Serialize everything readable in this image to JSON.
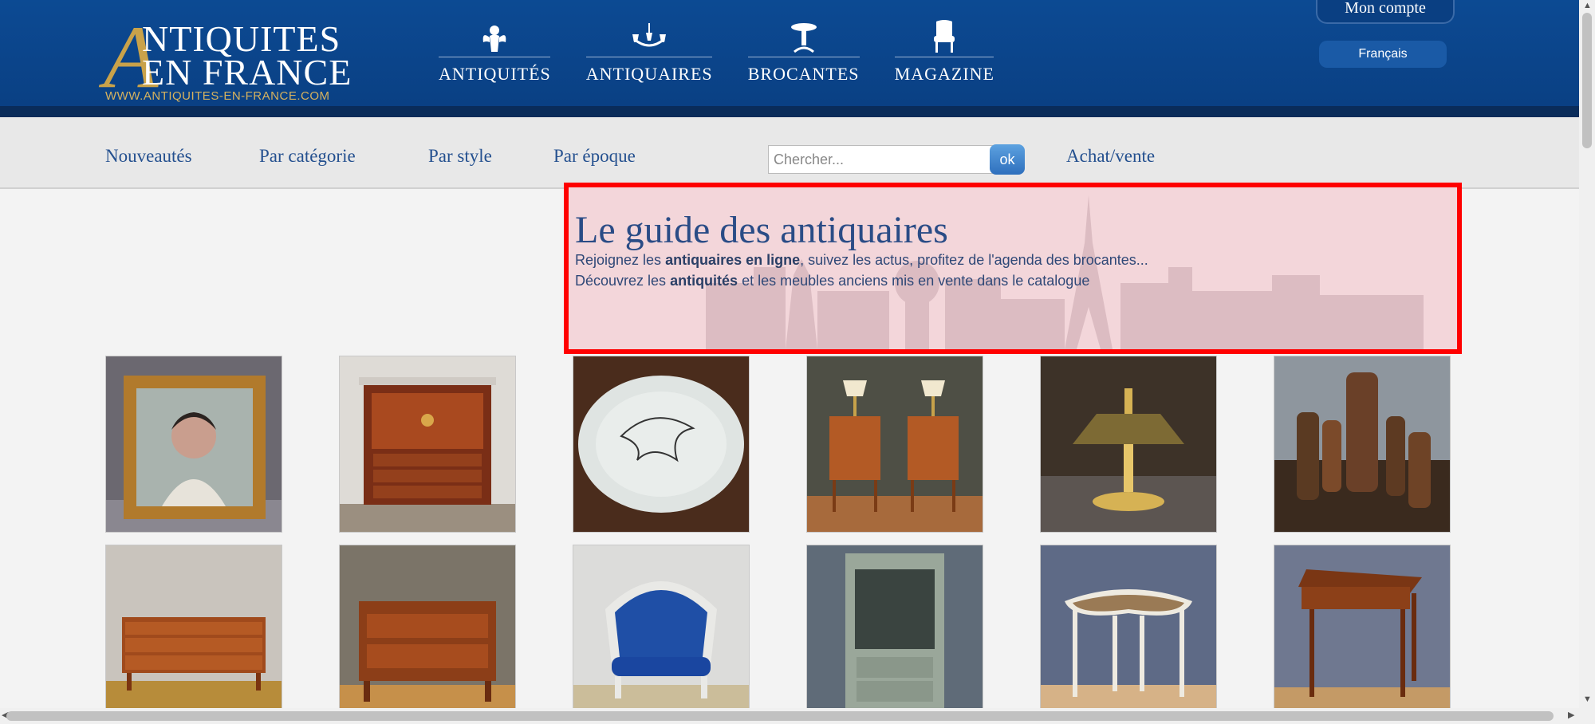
{
  "logo": {
    "initial": "A",
    "line1": "NTIQUITES",
    "line2": "EN FRANCE",
    "url": "WWW.ANTIQUITES-EN-FRANCE.COM"
  },
  "main_nav": [
    {
      "label": "ANTIQUITÉS",
      "icon": "cherub-icon"
    },
    {
      "label": "ANTIQUAIRES",
      "icon": "chandelier-icon"
    },
    {
      "label": "BROCANTES",
      "icon": "pedestal-table-icon"
    },
    {
      "label": "MAGAZINE",
      "icon": "armchair-icon"
    }
  ],
  "account": {
    "label": "Mon compte",
    "language": "Français"
  },
  "sub_nav": [
    {
      "label": "Nouveautés"
    },
    {
      "label": "Par catégorie"
    },
    {
      "label": "Par style"
    },
    {
      "label": "Par époque"
    },
    {
      "label": "Achat/vente"
    }
  ],
  "search": {
    "placeholder": "Chercher...",
    "button": "ok"
  },
  "hero": {
    "title": "Le guide des antiquaires",
    "line1_pre": "Rejoignez les ",
    "line1_bold": "antiquaires en ligne",
    "line1_post": ", suivez les actus, profitez de l'agenda des brocantes...",
    "line2_pre": "Découvrez les ",
    "line2_bold": "antiquités",
    "line2_post": " et les meubles anciens mis en vente dans le catalogue"
  },
  "products": [
    {
      "subject": "portrait-painting"
    },
    {
      "subject": "secretary-desk"
    },
    {
      "subject": "ceramic-plate"
    },
    {
      "subject": "nightstands-pair"
    },
    {
      "subject": "bouillotte-lamp"
    },
    {
      "subject": "ceramic-vases"
    },
    {
      "subject": "chest-of-drawers"
    },
    {
      "subject": "walnut-commode"
    },
    {
      "subject": "blue-bergere"
    },
    {
      "subject": "glass-cabinet"
    },
    {
      "subject": "cane-table"
    },
    {
      "subject": "side-table"
    }
  ],
  "colors": {
    "header": "#0c4a93",
    "gold": "#c9a24a",
    "link": "#24508f",
    "hero_bg": "#f3d6da",
    "highlight": "#ff0000"
  }
}
